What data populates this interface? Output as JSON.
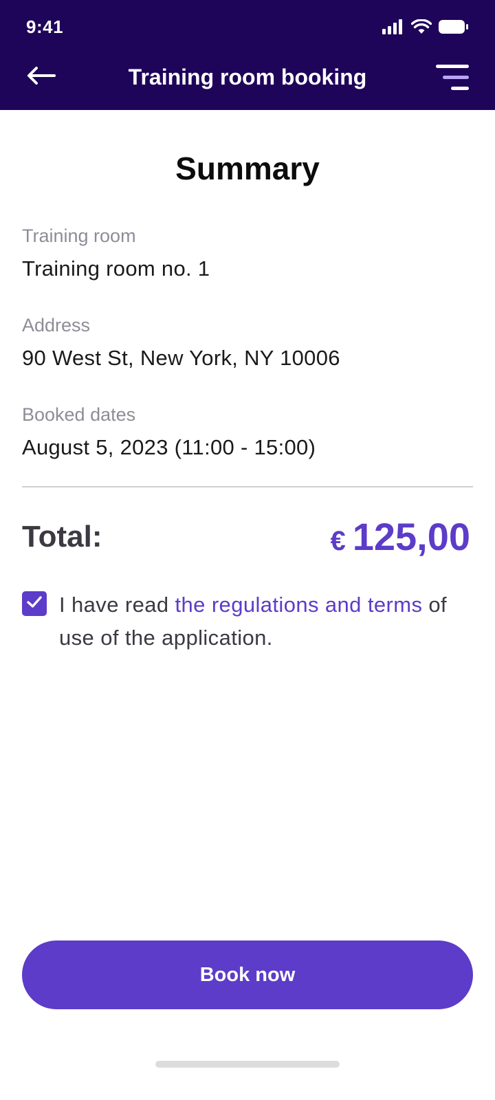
{
  "status_bar": {
    "time": "9:41"
  },
  "header": {
    "title": "Training room booking",
    "back_icon": "arrow-left-icon",
    "menu_icon": "filter-menu-icon"
  },
  "summary": {
    "title": "Summary",
    "fields": [
      {
        "label": "Training room",
        "value": "Training room no. 1"
      },
      {
        "label": "Address",
        "value": "90 West St, New York, NY 10006"
      },
      {
        "label": "Booked dates",
        "value": "August 5, 2023 (11:00 - 15:00)"
      }
    ],
    "total_label": "Total:",
    "currency": "€",
    "total_value": "125,00"
  },
  "consent": {
    "checked": true,
    "prefix": "I have read ",
    "link_text": "the regulations and terms",
    "suffix": " of use of the application."
  },
  "cta": {
    "label": "Book now"
  },
  "colors": {
    "header_bg": "#1e0559",
    "accent": "#5c3cc8",
    "menu_accent": "#b9a4f5"
  }
}
